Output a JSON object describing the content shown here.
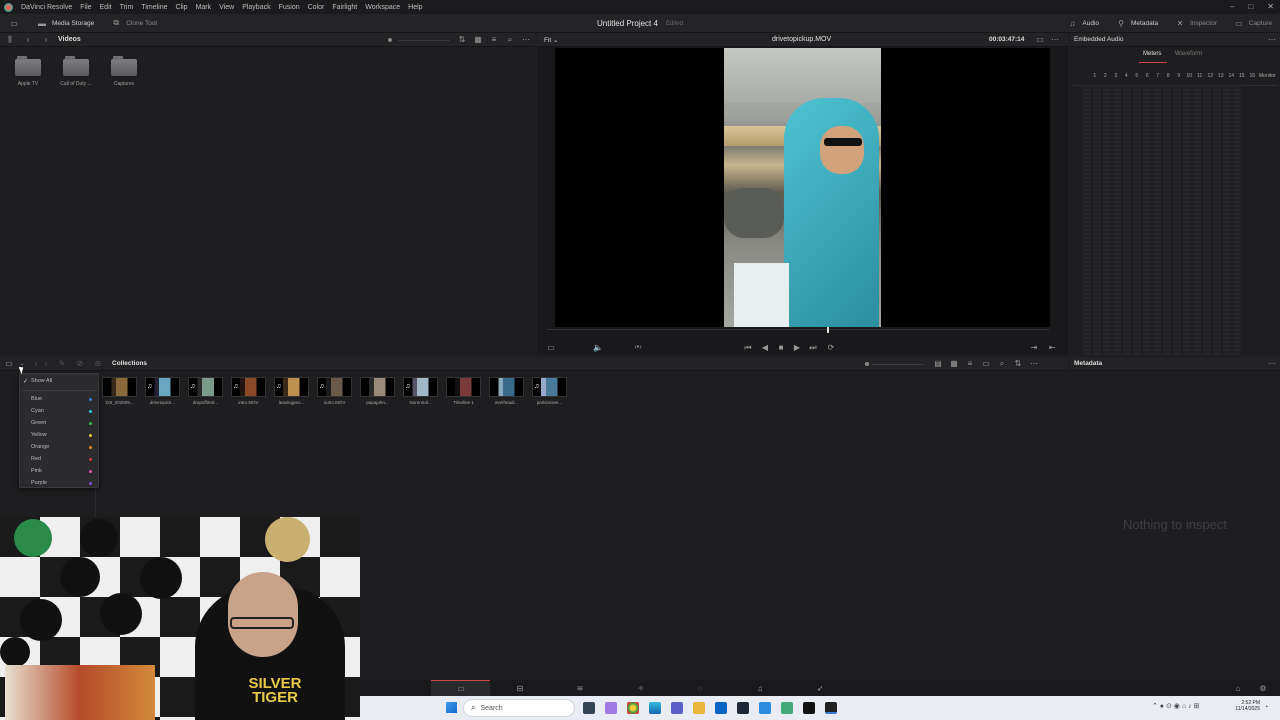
{
  "app": {
    "name": "DaVinci Resolve"
  },
  "menu": [
    "File",
    "Edit",
    "Trim",
    "Timeline",
    "Clip",
    "Mark",
    "View",
    "Playback",
    "Fusion",
    "Color",
    "Fairlight",
    "Workspace",
    "Help"
  ],
  "toolbar": {
    "media_storage": "Media Storage",
    "clone_tool": "Clone Tool",
    "project_title": "Untitled Project 4",
    "project_status": "Edited",
    "audio": "Audio",
    "metadata": "Metadata",
    "inspector": "Inspector",
    "capture": "Capture"
  },
  "media_storage": {
    "path": "Videos",
    "folders": [
      "Apple TV",
      "Call of Duty ...",
      "Captures"
    ]
  },
  "viewer": {
    "fit": "Fit",
    "clip_name": "drivetopickup.MOV",
    "timecode": "00:03:47:14"
  },
  "audio_panel": {
    "title": "Embedded Audio",
    "tab_meters": "Meters",
    "tab_waveform": "Waveform",
    "channels": [
      "1",
      "2",
      "3",
      "4",
      "5",
      "6",
      "7",
      "8",
      "9",
      "10",
      "11",
      "12",
      "13",
      "14",
      "15",
      "16"
    ],
    "monitor": "Monitor"
  },
  "media_pool": {
    "title": "Collections",
    "clips": [
      {
        "label": "DJI_202509...",
        "audio": false,
        "colors": [
          "#3a2a1a",
          "#8a6a3a"
        ]
      },
      {
        "label": "drivetopick...",
        "audio": true,
        "colors": [
          "#223",
          "#6aa7c0"
        ]
      },
      {
        "label": "dropoff2nd...",
        "audio": true,
        "colors": [
          "#2a2a2a",
          "#7a9a8a"
        ]
      },
      {
        "label": "intro.MOV",
        "audio": true,
        "colors": [
          "#221512",
          "#8a4a2a"
        ]
      },
      {
        "label": "leavingpeo...",
        "audio": true,
        "colors": [
          "#3a2a1a",
          "#c09050"
        ]
      },
      {
        "label": "outro.MOV",
        "audio": true,
        "colors": [
          "#1a1a1a",
          "#6a5a4a"
        ]
      },
      {
        "label": "papajohn...",
        "audio": false,
        "colors": [
          "#2a2a2a",
          "#9a8a7a"
        ]
      },
      {
        "label": "storerotol...",
        "audio": true,
        "colors": [
          "#556",
          "#a0b8c8"
        ]
      },
      {
        "label": "Timeline 1",
        "audio": false,
        "colors": [
          "#111",
          "#7a3a3a"
        ]
      },
      {
        "label": "overheadi...",
        "audio": false,
        "colors": [
          "#8ab",
          "#3a6a8a"
        ]
      },
      {
        "label": "parkinssee...",
        "audio": true,
        "colors": [
          "#9ac",
          "#4a7a9a"
        ]
      }
    ]
  },
  "color_filter": {
    "show_all": "Show All",
    "options": [
      {
        "label": "Blue",
        "color": "#3a7bd5"
      },
      {
        "label": "Cyan",
        "color": "#2ac6d6"
      },
      {
        "label": "Green",
        "color": "#3bb54a"
      },
      {
        "label": "Yellow",
        "color": "#e6c62b"
      },
      {
        "label": "Orange",
        "color": "#e8872a"
      },
      {
        "label": "Red",
        "color": "#d23a3a"
      },
      {
        "label": "Pink",
        "color": "#e04fb3"
      },
      {
        "label": "Purple",
        "color": "#8a4fd8"
      }
    ]
  },
  "metadata_panel": {
    "title": "Metadata",
    "empty": "Nothing to inspect"
  },
  "taskbar": {
    "search": "Search",
    "time": "2:52 PM",
    "date": "11/14/2025"
  },
  "webcam": {
    "shirt_text_1": "SILVER",
    "shirt_text_2": "TIGER"
  },
  "colors": {
    "accent_red": "#d0474b",
    "bg": "#1f1f21"
  }
}
